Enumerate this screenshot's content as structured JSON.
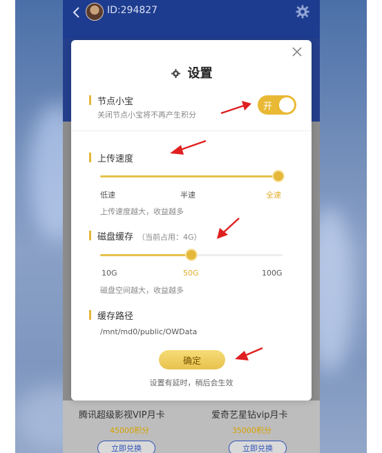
{
  "header": {
    "user_id": "ID:294827"
  },
  "settings_dialog": {
    "title": "设置",
    "node": {
      "title": "节点小宝",
      "subtitle": "关闭节点小宝将不再产生积分",
      "toggle_label": "开",
      "enabled": true
    },
    "upload_speed": {
      "title": "上传速度",
      "ticks": [
        "低速",
        "半速",
        "全速"
      ],
      "selected": "全速",
      "level": 1.0,
      "hint": "上传速度越大，收益越多"
    },
    "disk_cache": {
      "title": "磁盘缓存",
      "usage": "（当前占用：4G）",
      "ticks": [
        "10G",
        "50G",
        "100G"
      ],
      "selected": "50G",
      "level": 0.5,
      "hint": "磁盘空间越大，收益越多"
    },
    "cache_path": {
      "title": "缓存路径",
      "value": "/mnt/md0/public/OWData"
    },
    "confirm_label": "确定",
    "note": "设置有延时，稍后会生效"
  },
  "background_cards": [
    {
      "title": "腾讯超级影视VIP月卡",
      "points": "45000积分",
      "button": "立即兑换"
    },
    {
      "title": "爱奇艺星钻vip月卡",
      "points": "35000积分",
      "button": "立即兑换"
    }
  ],
  "colors": {
    "accent": "#e6b83a",
    "header_blue": "#1e3c8f",
    "arrow_red": "#e02020"
  },
  "icons": [
    "back-arrow-icon",
    "avatar",
    "gear-icon",
    "close-icon",
    "arrow-annotation"
  ]
}
